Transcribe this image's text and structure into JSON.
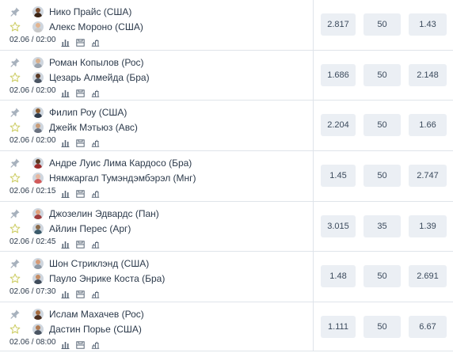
{
  "colors": {
    "row_border": "#dfe4ea",
    "odd_bg": "#ebeff4",
    "pin": "#a7b1bd",
    "star": "#cfcf6a",
    "stat_icon": "#5b6878"
  },
  "icons": {
    "pin": "pin-icon",
    "favorite": "star-outline-icon",
    "stats": "bar-chart-icon",
    "lineup": "field-stats-icon",
    "tree": "bracket-icon"
  },
  "events": [
    {
      "fighter1": "Нико Прайс (США)",
      "fighter2": "Алекс Мороно (США)",
      "time": "02.06 / 02:00",
      "odds": [
        "2.817",
        "50",
        "1.43"
      ]
    },
    {
      "fighter1": "Роман Копылов (Рос)",
      "fighter2": "Цезарь Алмейда (Бра)",
      "time": "02.06 / 02:00",
      "odds": [
        "1.686",
        "50",
        "2.148"
      ]
    },
    {
      "fighter1": "Филип Роу (США)",
      "fighter2": "Джейк Мэтьюз (Авс)",
      "time": "02.06 / 02:00",
      "odds": [
        "2.204",
        "50",
        "1.66"
      ]
    },
    {
      "fighter1": "Андре Луис Лима Кардосо (Бра)",
      "fighter2": "Нямжаргал Тумэндэмбэрэл (Мнг)",
      "time": "02.06 / 02:15",
      "odds": [
        "1.45",
        "50",
        "2.747"
      ]
    },
    {
      "fighter1": "Джозелин Эдвардс (Пан)",
      "fighter2": "Айлин Перес (Арг)",
      "time": "02.06 / 02:45",
      "odds": [
        "3.015",
        "35",
        "1.39"
      ]
    },
    {
      "fighter1": "Шон Стриклэнд (США)",
      "fighter2": "Пауло Энрике Коста (Бра)",
      "time": "02.06 / 07:30",
      "odds": [
        "1.48",
        "50",
        "2.691"
      ]
    },
    {
      "fighter1": "Ислам Махачев (Рос)",
      "fighter2": "Дастин Порье (США)",
      "time": "02.06 / 08:00",
      "odds": [
        "1.111",
        "50",
        "6.67"
      ]
    }
  ]
}
